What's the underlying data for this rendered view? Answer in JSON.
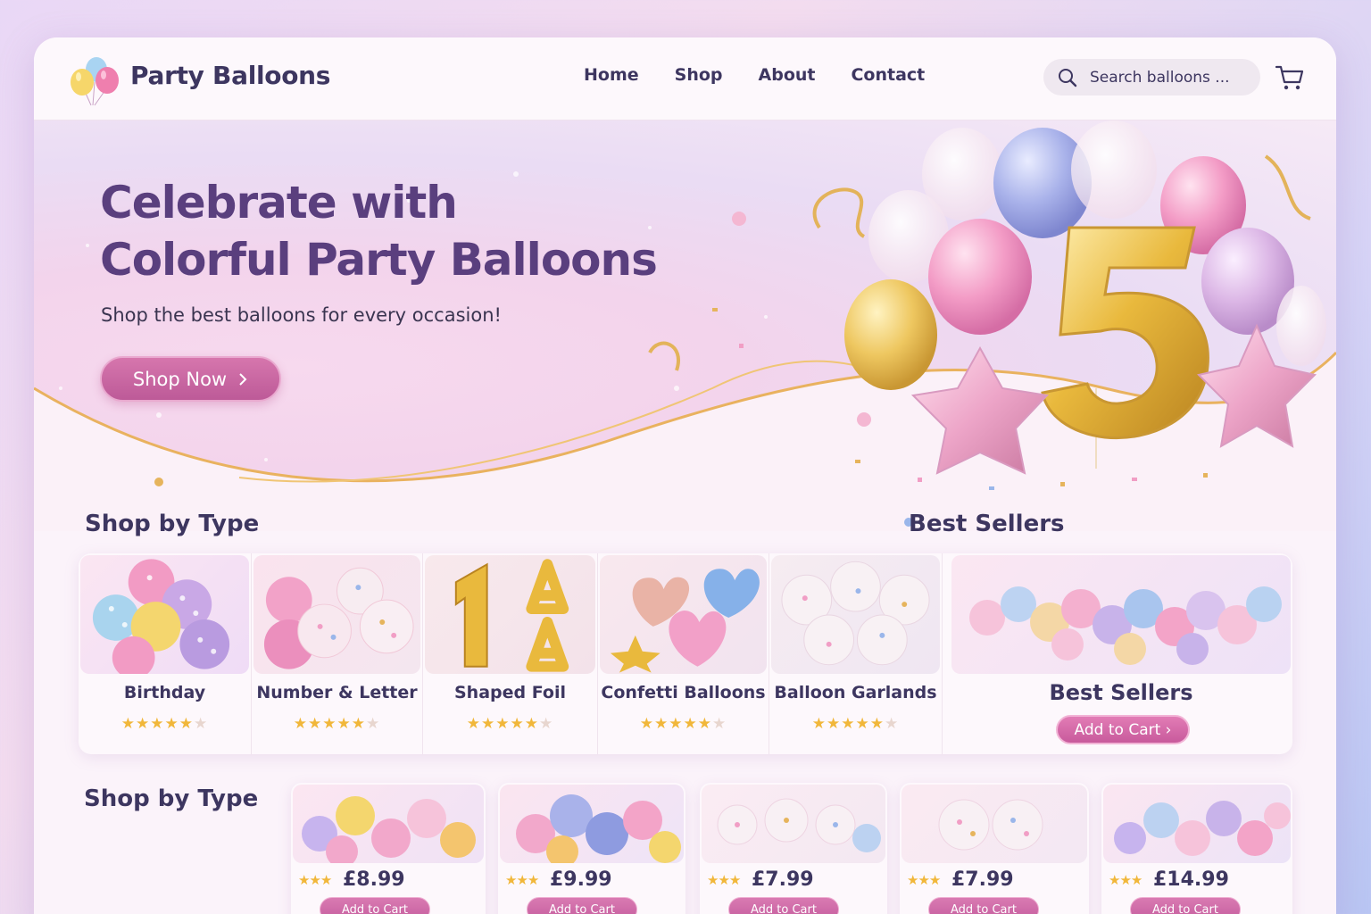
{
  "header": {
    "brand": "Party Balloons",
    "nav": [
      "Home",
      "Shop",
      "About",
      "Contact"
    ],
    "search_placeholder": "Search balloons ..."
  },
  "hero": {
    "title_line1": "Celebrate with",
    "title_line2": "Colorful Party Balloons",
    "subtitle": "Shop the best balloons for every occasion!",
    "cta": "Shop Now",
    "featured_number": "5"
  },
  "sections": {
    "shop_by_type": "Shop by Type",
    "best_sellers": "Best Sellers",
    "shop_by_type_2": "Shop by Type"
  },
  "types": [
    {
      "label": "Birthday",
      "rating": 4.5
    },
    {
      "label": "Number & Letter",
      "rating": 4.5
    },
    {
      "label": "Shaped Foil",
      "rating": 4.5
    },
    {
      "label": "Confetti Balloons",
      "rating": 4.5
    },
    {
      "label": "Balloon Garlands",
      "rating": 4.5
    }
  ],
  "best_card": {
    "label": "Best Sellers",
    "button": "Add to Cart ›"
  },
  "products": [
    {
      "price": "£8.99",
      "button": "Add to Cart"
    },
    {
      "price": "£9.99",
      "button": "Add to Cart"
    },
    {
      "price": "£7.99",
      "button": "Add to Cart"
    },
    {
      "price": "£7.99",
      "button": "Add to Cart"
    },
    {
      "price": "£14.99",
      "button": "Add to Cart"
    }
  ],
  "colors": {
    "brand_text": "#3d3660",
    "hero_title": "#5a3f7e",
    "accent_pink": "#c85a9c",
    "star": "#f1b73a"
  },
  "icons": [
    "balloon-logo-icon",
    "search-icon",
    "cart-icon",
    "chevron-right-icon",
    "star-icon"
  ]
}
